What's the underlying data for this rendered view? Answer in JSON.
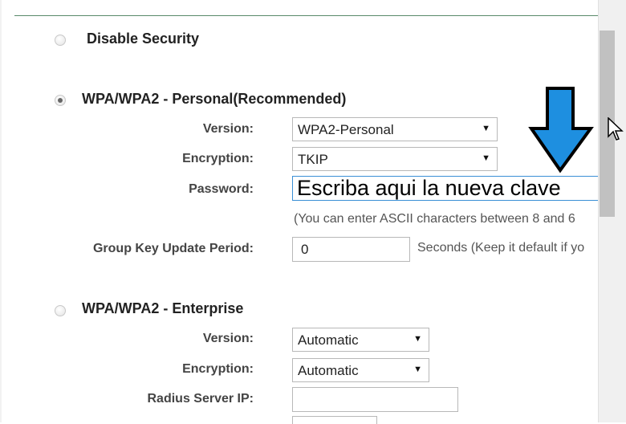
{
  "sections": {
    "disable": {
      "title": "Disable Security",
      "checked": false
    },
    "personal": {
      "title": "WPA/WPA2 - Personal(Recommended)",
      "checked": true,
      "version_label": "Version:",
      "version_value": "WPA2-Personal",
      "encryption_label": "Encryption:",
      "encryption_value": "TKIP",
      "password_label": "Password:",
      "password_value": "Escriba aqui la nueva clave",
      "password_hint": "(You can enter ASCII characters between 8 and 6",
      "group_key_label": "Group Key Update Period:",
      "group_key_value": "0",
      "group_key_hint": "Seconds (Keep it default if yo"
    },
    "enterprise": {
      "title": "WPA/WPA2 - Enterprise",
      "checked": false,
      "version_label": "Version:",
      "version_value": "Automatic",
      "encryption_label": "Encryption:",
      "encryption_value": "Automatic",
      "radius_ip_label": "Radius Server IP:",
      "radius_ip_value": ""
    }
  },
  "icons": {
    "dropdown": "chevron-down-icon",
    "annotation": "arrow-down-icon",
    "cursor": "mouse-pointer-icon"
  },
  "colors": {
    "annotation_arrow": "#1e8fe0",
    "active_border": "#3a8fd6"
  }
}
